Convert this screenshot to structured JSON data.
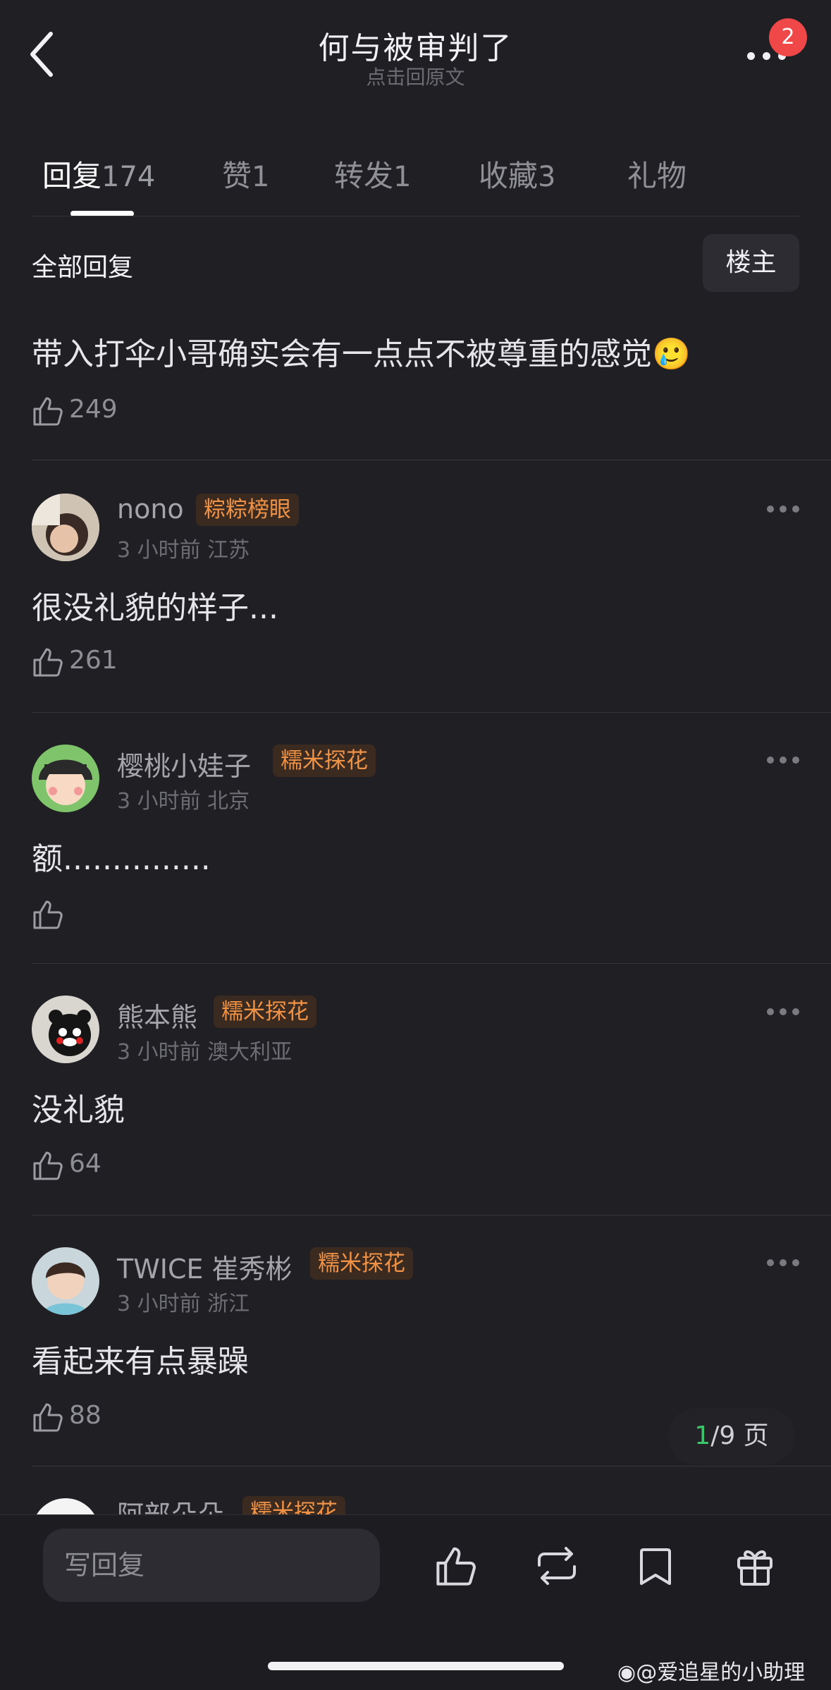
{
  "header": {
    "title": "何与被审判了",
    "subtitle": "点击回原文",
    "notification_count": "2",
    "back_icon": "chevron-left-icon",
    "more_icon": "ellipsis-icon"
  },
  "tabs": [
    {
      "label": "回复",
      "count": "174"
    },
    {
      "label": "赞",
      "count": "1"
    },
    {
      "label": "转发",
      "count": "1"
    },
    {
      "label": "收藏",
      "count": "3"
    },
    {
      "label": "礼物",
      "count": ""
    }
  ],
  "section": {
    "all_replies": "全部回复",
    "floor_button": "楼主"
  },
  "top_comment": {
    "text": "带入打伞小哥确实会有一点点不被尊重的感觉",
    "emoji": "🥲",
    "likes": "249"
  },
  "comments": [
    {
      "user": "nono",
      "tag": "粽粽榜眼",
      "time": "3 小时前",
      "location": "江苏",
      "text": "很没礼貌的样子...",
      "likes": "261"
    },
    {
      "user": "樱桃小娃子",
      "tag": "糯米探花",
      "time": "3 小时前",
      "location": "北京",
      "text": "额...............",
      "likes": ""
    },
    {
      "user": "熊本熊",
      "tag": "糯米探花",
      "time": "3 小时前",
      "location": "澳大利亚",
      "text": "没礼貌",
      "likes": "64"
    },
    {
      "user": "TWICE 崔秀彬",
      "tag": "糯米探花",
      "time": "3 小时前",
      "location": "浙江",
      "text": "看起来有点暴躁",
      "likes": "88"
    },
    {
      "user": "阿部朵朵",
      "tag": "糯米探花",
      "time": "",
      "location": "",
      "text": "",
      "likes": ""
    }
  ],
  "pagination": {
    "current": "1",
    "total": "/9 页"
  },
  "bottom_bar": {
    "reply_placeholder": "写回复",
    "icons": [
      "thumbs-up-icon",
      "repost-icon",
      "bookmark-icon",
      "gift-icon"
    ]
  },
  "watermark": "@爱追星的小助理",
  "colors": {
    "background": "#1f1f24",
    "tag_orange": "#f09347",
    "badge_red": "#f04848",
    "page_green": "#3ec46d"
  }
}
